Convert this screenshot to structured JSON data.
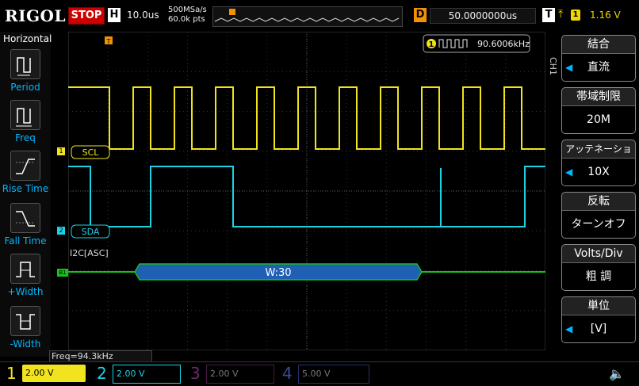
{
  "header": {
    "logo": "RIGOL",
    "run_state": "STOP",
    "horizontal_badge": "H",
    "timebase": "10.0us",
    "sample_rate": "500MSa/s",
    "memory_depth": "60.0k pts",
    "delay_badge": "D",
    "delay": "50.0000000us",
    "trigger_badge": "T",
    "trigger_source": "1",
    "trigger_level": "1.16 V"
  },
  "left_menu": {
    "title": "Horizontal",
    "items": [
      {
        "label": "Period"
      },
      {
        "label": "Freq"
      },
      {
        "label": "Rise Time"
      },
      {
        "label": "Fall Time"
      },
      {
        "label": "+Width"
      },
      {
        "label": "-Width"
      }
    ]
  },
  "channels": {
    "ch1": {
      "label": "SCL",
      "marker": "1",
      "color": "#f1e41e"
    },
    "ch2": {
      "label": "SDA",
      "marker": "2",
      "color": "#1ed2e6"
    },
    "bus": {
      "label": "I2C[ASC]",
      "marker": "B1",
      "color": "#18c018",
      "decode": "W:30",
      "decode_color": "#1f5fb4"
    }
  },
  "measurement": {
    "channel": "1",
    "value": "90.6006kHz"
  },
  "right_menu": {
    "channel_label": "CH1",
    "blocks": [
      {
        "title": "結合",
        "value": "直流"
      },
      {
        "title": "帯域制限",
        "value": "20M"
      },
      {
        "title": "アッテネーション",
        "value": "10X"
      },
      {
        "title": "反転",
        "value": "ターンオフ"
      },
      {
        "title": "Volts/Div",
        "value": "粗 調"
      },
      {
        "title": "単位",
        "value": "[V]"
      }
    ]
  },
  "bottom": {
    "freq": "Freq=94.3kHz",
    "ch1": {
      "num": "1",
      "scale": "2.00 V",
      "color": "#f1e41e"
    },
    "ch2": {
      "num": "2",
      "scale": "2.00 V",
      "color": "#1ed2e6"
    },
    "ch3": {
      "num": "3",
      "scale": "2.00 V",
      "color": "#c040c0"
    },
    "ch4": {
      "num": "4",
      "scale": "5.00 V",
      "color": "#3050d0"
    }
  },
  "colors": {
    "accent": "#00b7ff",
    "trigger": "#f39200",
    "stop": "#cc0000"
  }
}
